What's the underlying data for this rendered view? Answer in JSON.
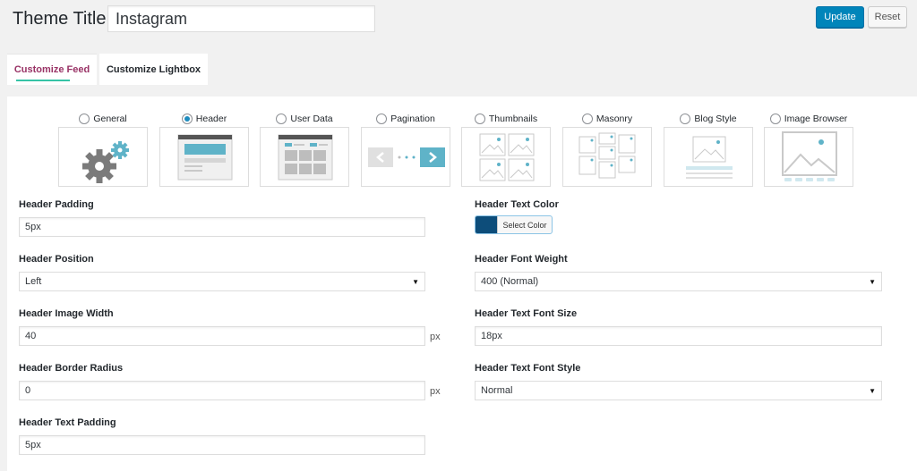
{
  "header": {
    "title_label": "Theme Title",
    "title_value": "Instagram",
    "update_label": "Update",
    "reset_label": "Reset"
  },
  "tabs": [
    {
      "label": "Customize Feed",
      "active": true
    },
    {
      "label": "Customize Lightbox",
      "active": false
    }
  ],
  "theme_types": [
    {
      "label": "General",
      "icon": "gears-icon",
      "checked": false
    },
    {
      "label": "Header",
      "icon": "header-layout-icon",
      "checked": true
    },
    {
      "label": "User Data",
      "icon": "user-data-layout-icon",
      "checked": false
    },
    {
      "label": "Pagination",
      "icon": "pagination-arrows-icon",
      "checked": false
    },
    {
      "label": "Thumbnails",
      "icon": "thumbnails-grid-icon",
      "checked": false
    },
    {
      "label": "Masonry",
      "icon": "masonry-grid-icon",
      "checked": false
    },
    {
      "label": "Blog Style",
      "icon": "blog-style-icon",
      "checked": false
    },
    {
      "label": "Image Browser",
      "icon": "image-browser-icon",
      "checked": false
    }
  ],
  "form": {
    "header_padding": {
      "label": "Header Padding",
      "value": "5px"
    },
    "header_position": {
      "label": "Header Position",
      "value": "Left"
    },
    "header_image_width": {
      "label": "Header Image Width",
      "value": "40",
      "unit": "px"
    },
    "header_border_radius": {
      "label": "Header Border Radius",
      "value": "0",
      "unit": "px"
    },
    "header_text_padding": {
      "label": "Header Text Padding",
      "value": "5px"
    },
    "header_text_color": {
      "label": "Header Text Color",
      "button_label": "Select Color",
      "color": "#0d4d7a"
    },
    "header_font_weight": {
      "label": "Header Font Weight",
      "value": "400 (Normal)"
    },
    "header_text_font_size": {
      "label": "Header Text Font Size",
      "value": "18px"
    },
    "header_text_font_style": {
      "label": "Header Text Font Style",
      "value": "Normal"
    }
  },
  "colors": {
    "accent_blue": "#0085ba",
    "icon_teal": "#5fb3c8",
    "active_tab": "#993366"
  }
}
